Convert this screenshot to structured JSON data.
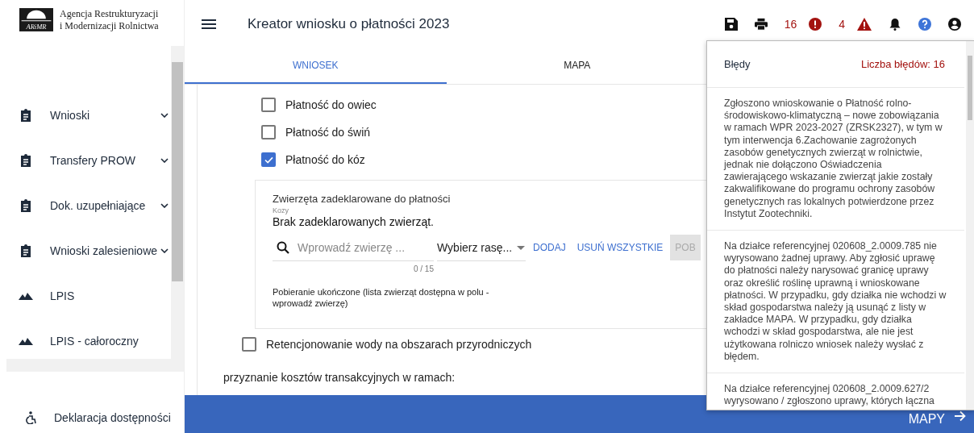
{
  "logo": {
    "line_1": "Agencja Restrukturyzacji",
    "line_2": "i Modernizacji Rolnictwa",
    "mark": "ARiMR"
  },
  "sidebar": {
    "items": [
      {
        "label": "Wnioski",
        "kind": "document",
        "expandable": true
      },
      {
        "label": "Transfery PROW",
        "kind": "document",
        "expandable": true
      },
      {
        "label": "Dok. uzupełniające",
        "kind": "document",
        "expandable": true
      },
      {
        "label": "Wnioski zalesieniowe",
        "kind": "document",
        "expandable": true
      },
      {
        "label": "LPIS",
        "kind": "map",
        "expandable": false
      },
      {
        "label": "LPIS - całoroczny",
        "kind": "map",
        "expandable": false
      }
    ],
    "footer_link": "Deklaracja dostępności"
  },
  "header": {
    "title": "Kreator wniosku o płatności 2023",
    "error_count": "16",
    "warning_count": "4"
  },
  "tabs": [
    {
      "label": "WNIOSEK",
      "selected": true
    },
    {
      "label": "MAPA",
      "selected": false
    }
  ],
  "options": [
    {
      "label": "Płatność do owiec",
      "checked": false
    },
    {
      "label": "Płatność do świń",
      "checked": false
    },
    {
      "label": "Płatność do kóz",
      "checked": true
    }
  ],
  "animals": {
    "title": "Zwierzęta zadeklarowane do płatności",
    "subtitle": "Kozy",
    "empty_text": "Brak zadeklarowanych zwierząt.",
    "search_placeholder": "Wprowadź zwierzę ...",
    "counter": "0 / 15",
    "breed_placeholder": "Wybierz rasę...",
    "add_button": "DODAJ",
    "remove_all_button": "USUŃ WSZYSTKIE",
    "download_button": "POB",
    "status": "Pobieranie ukończone (lista zwierząt dostępna w polu - wprowadź zwierzę)"
  },
  "water_option": {
    "label": "Retencjonowanie wody na obszarach przyrodniczych",
    "checked": false
  },
  "transaction_costs_label": "przyznanie kosztów transakcyjnych w ramach:",
  "next_button": "MAPY",
  "errors_panel": {
    "title": "Błędy",
    "count_label": "Liczba błędów: 16",
    "errors": [
      "Zgłoszono wnioskowanie o Płatność rolno-środowiskowo-klimatyczną – nowe zobowiązania w ramach WPR 2023-2027 (ZRSK2327), w tym w tym interwencja 6.Zachowanie zagrożonych zasobów genetycznych zwierząt w rolnictwie, jednak nie dołączono Oświadczenia zawierającego wskazanie zwierząt jakie zostały zakwalifikowane do programu ochrony zasobów genetycznych ras lokalnych potwierdzone przez Instytut Zootechniki.",
      "Na działce referencyjnej 020608_2.0009.785 nie wyrysowano żadnej uprawy. Aby zgłosić uprawę do płatności należy narysować granicę uprawy oraz określić roślinę uprawną i wnioskowane płatności. W przypadku, gdy działka nie wchodzi w skład gospodarstwa należy ją usunąć z listy w zakładce MAPA. W przypadku, gdy działka wchodzi w skład gospodarstwa, ale nie jest użytkowana rolniczo wniosek należy wysłać z błędem.",
      "Na działce referencyjnej 020608_2.0009.627/2 wyrysowano / zgłoszono uprawy, których łączna"
    ]
  }
}
